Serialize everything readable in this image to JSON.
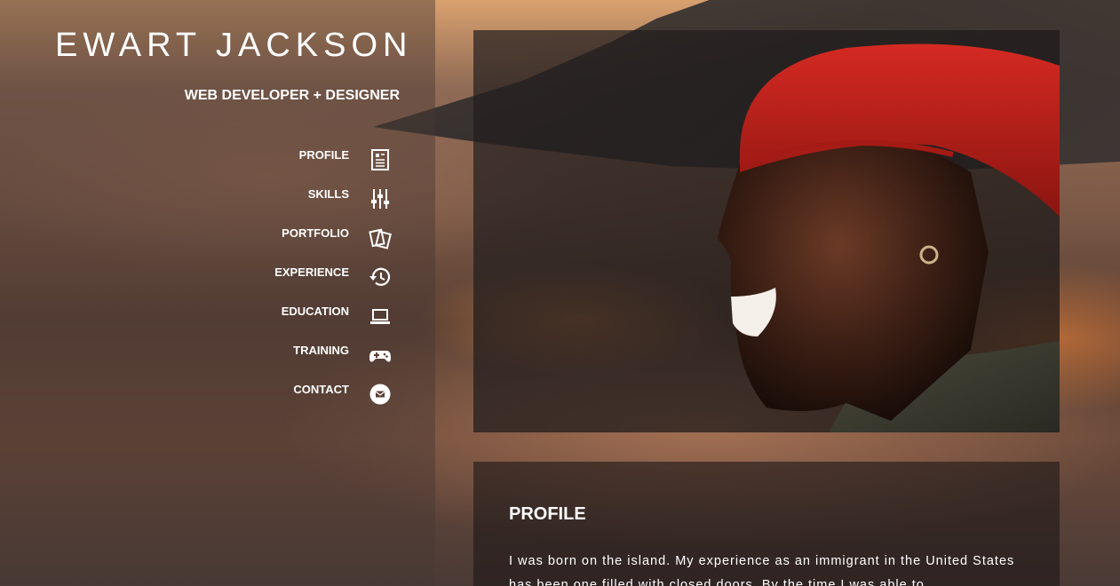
{
  "header": {
    "name": "EWART JACKSON",
    "subtitle": "WEB DEVELOPER + DESIGNER"
  },
  "nav": {
    "items": [
      {
        "label": "PROFILE",
        "icon": "document-icon"
      },
      {
        "label": "SKILLS",
        "icon": "sliders-icon"
      },
      {
        "label": "PORTFOLIO",
        "icon": "cards-icon"
      },
      {
        "label": "EXPERIENCE",
        "icon": "history-icon"
      },
      {
        "label": "EDUCATION",
        "icon": "laptop-icon"
      },
      {
        "label": "TRAINING",
        "icon": "gamepad-icon"
      },
      {
        "label": "CONTACT",
        "icon": "mail-icon"
      }
    ]
  },
  "profile": {
    "title": "PROFILE",
    "text": "I was born on the island. My experience as an immigrant in the United States has been one filled with closed doors. By the time I was able to"
  },
  "colors": {
    "hat": "#c0221c",
    "text": "#ffffff",
    "sidebar_overlay": "rgba(70,55,50,0.45)"
  }
}
